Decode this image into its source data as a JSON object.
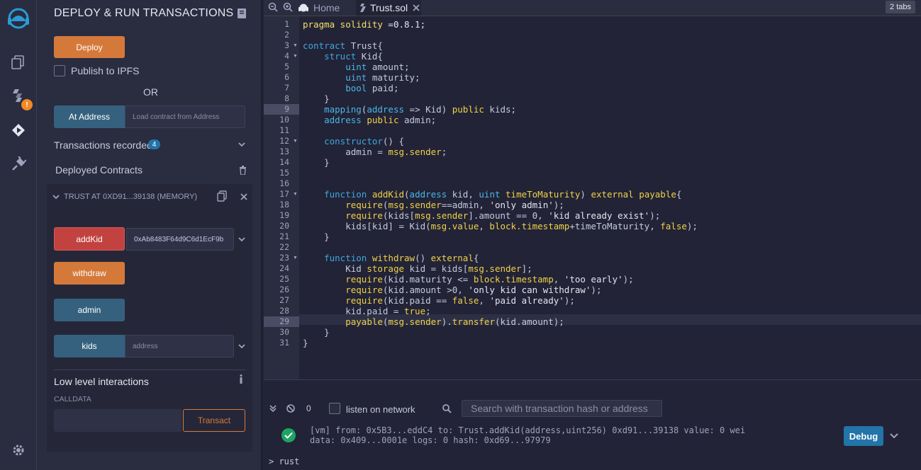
{
  "panel": {
    "title": "DEPLOY & RUN TRANSACTIONS",
    "deploy_label": "Deploy",
    "publish_label": "Publish to IPFS",
    "or_label": "OR",
    "at_address_label": "At Address",
    "load_contract_placeholder": "Load contract from Address",
    "transactions_recorded_label": "Transactions recorded",
    "transactions_count": "4",
    "deployed_contracts_label": "Deployed Contracts",
    "instance_label": "TRUST AT 0XD91...39138 (MEMORY)",
    "functions": {
      "addKid_label": "addKid",
      "addKid_value": "0xAb8483F64d9C6d1EcF9b",
      "withdraw_label": "withdraw",
      "admin_label": "admin",
      "kids_label": "kids",
      "kids_placeholder": "address"
    },
    "low_level_label": "Low level interactions",
    "calldata_label": "CALLDATA",
    "transact_label": "Transact"
  },
  "rail": {
    "plugin_badge": "!"
  },
  "tabs": {
    "home_label": "Home",
    "file_label": "Trust.sol",
    "count_label": "2 tabs"
  },
  "code_lines": [
    "1",
    "2",
    "3",
    "4",
    "5",
    "6",
    "7",
    "8",
    "9",
    "10",
    "11",
    "12",
    "13",
    "14",
    "15",
    "16",
    "17",
    "18",
    "19",
    "20",
    "21",
    "22",
    "23",
    "24",
    "25",
    "26",
    "27",
    "28",
    "29",
    "30",
    "31"
  ],
  "terminal": {
    "pending_count": "0",
    "listen_label": "listen on network",
    "search_placeholder": "Search with transaction hash or address",
    "log_line1": "[vm] from: 0x5B3...eddC4 to: Trust.addKid(address,uint256) 0xd91...39138 value: 0 wei",
    "log_line2": "data: 0x409...0001e logs: 0 hash: 0xd69...97979",
    "debug_label": "Debug",
    "prompt_text": "rust"
  },
  "colors": {
    "deploy": "#d5793a",
    "addkid": "#c2423f",
    "call": "#35617e",
    "success": "#1ea362"
  }
}
